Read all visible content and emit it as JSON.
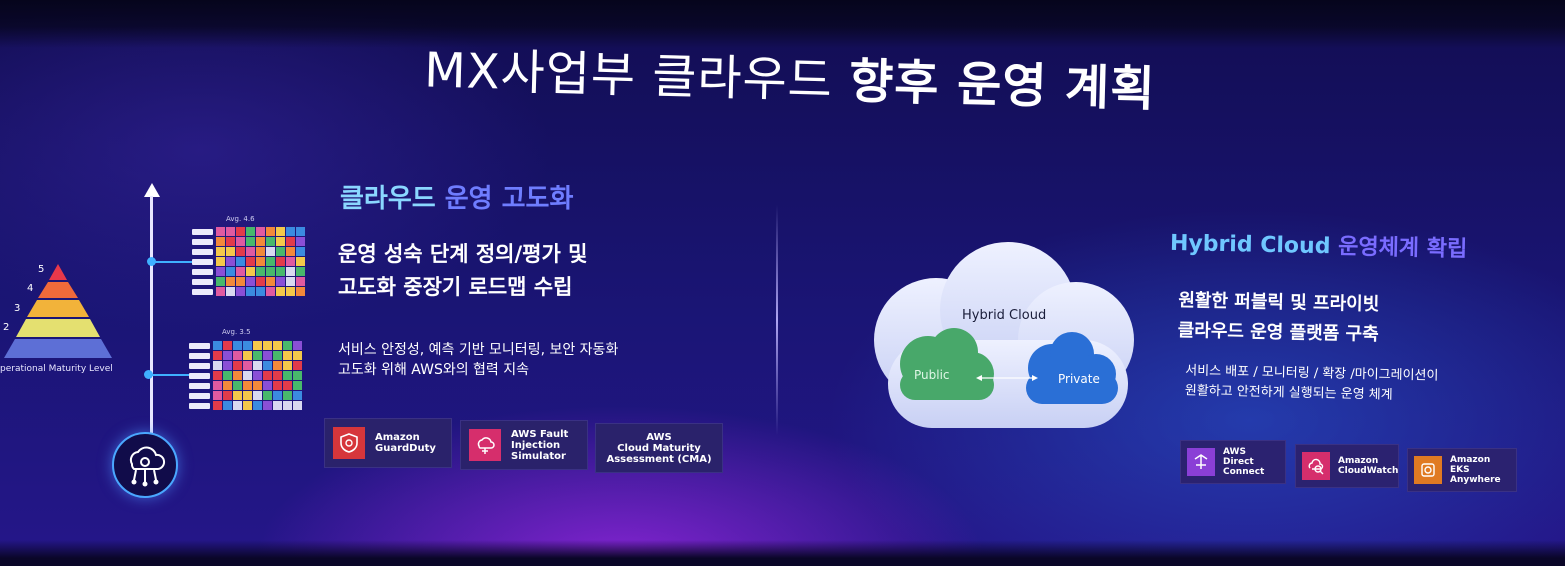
{
  "slide": {
    "title_light": "MX사업부 클라우드 ",
    "title_bold": "향후 운영 계획"
  },
  "left": {
    "heading_part1": "클라우드 ",
    "heading_part2": "운영 고도화",
    "subheading_line1": "운영 성숙 단계 정의/평가 및",
    "subheading_line2": "고도화 중장기 로드맵 수립",
    "desc_line1": "서비스 안정성, 예측 기반 모니터링, 보안 자동화",
    "desc_line2": "고도화 위해 AWS와의 협력 지속",
    "pyramid_levels": [
      "5",
      "4",
      "3",
      "2"
    ],
    "maturity_label": "perational Maturity Level",
    "avg_top": "Avg. 4.6",
    "avg_bottom": "Avg. 3.5",
    "badges": [
      {
        "label": "Amazon\nGuardDuty",
        "icon": "guardduty-icon",
        "color": "#d6363b"
      },
      {
        "label": "AWS Fault\nInjection\nSimulator",
        "icon": "fault-injection-icon",
        "color": "#d62e6c"
      },
      {
        "label": "AWS\nCloud Maturity\nAssessment (CMA)",
        "icon": "",
        "color": ""
      }
    ]
  },
  "right": {
    "heading_part1": "Hybrid Cloud ",
    "heading_part2": "운영체계 확립",
    "subheading_line1": "원활한 퍼블릭 및 프라이빗",
    "subheading_line2": "클라우드 운영 플랫폼 구축",
    "desc_line1": "서비스 배포 / 모니터링 / 확장 /마이그레이션이",
    "desc_line2": "원활하고 안전하게 실행되는 운영 체계",
    "cloud_title": "Hybrid Cloud",
    "public_label": "Public",
    "private_label": "Private",
    "badges": [
      {
        "label": "AWS Direct\nConnect",
        "icon": "direct-connect-icon",
        "color": "#8a3fd6"
      },
      {
        "label": "Amazon\nCloudWatch",
        "icon": "cloudwatch-icon",
        "color": "#d62e6c"
      },
      {
        "label": "Amazon\nEKS Anywhere",
        "icon": "eks-anywhere-icon",
        "color": "#e07a22"
      }
    ]
  },
  "colors": {
    "accent_cyan": "#8ad7ff",
    "accent_violet": "#6f7dff",
    "public_green": "#48a86a",
    "private_blue": "#2a6fd6"
  }
}
